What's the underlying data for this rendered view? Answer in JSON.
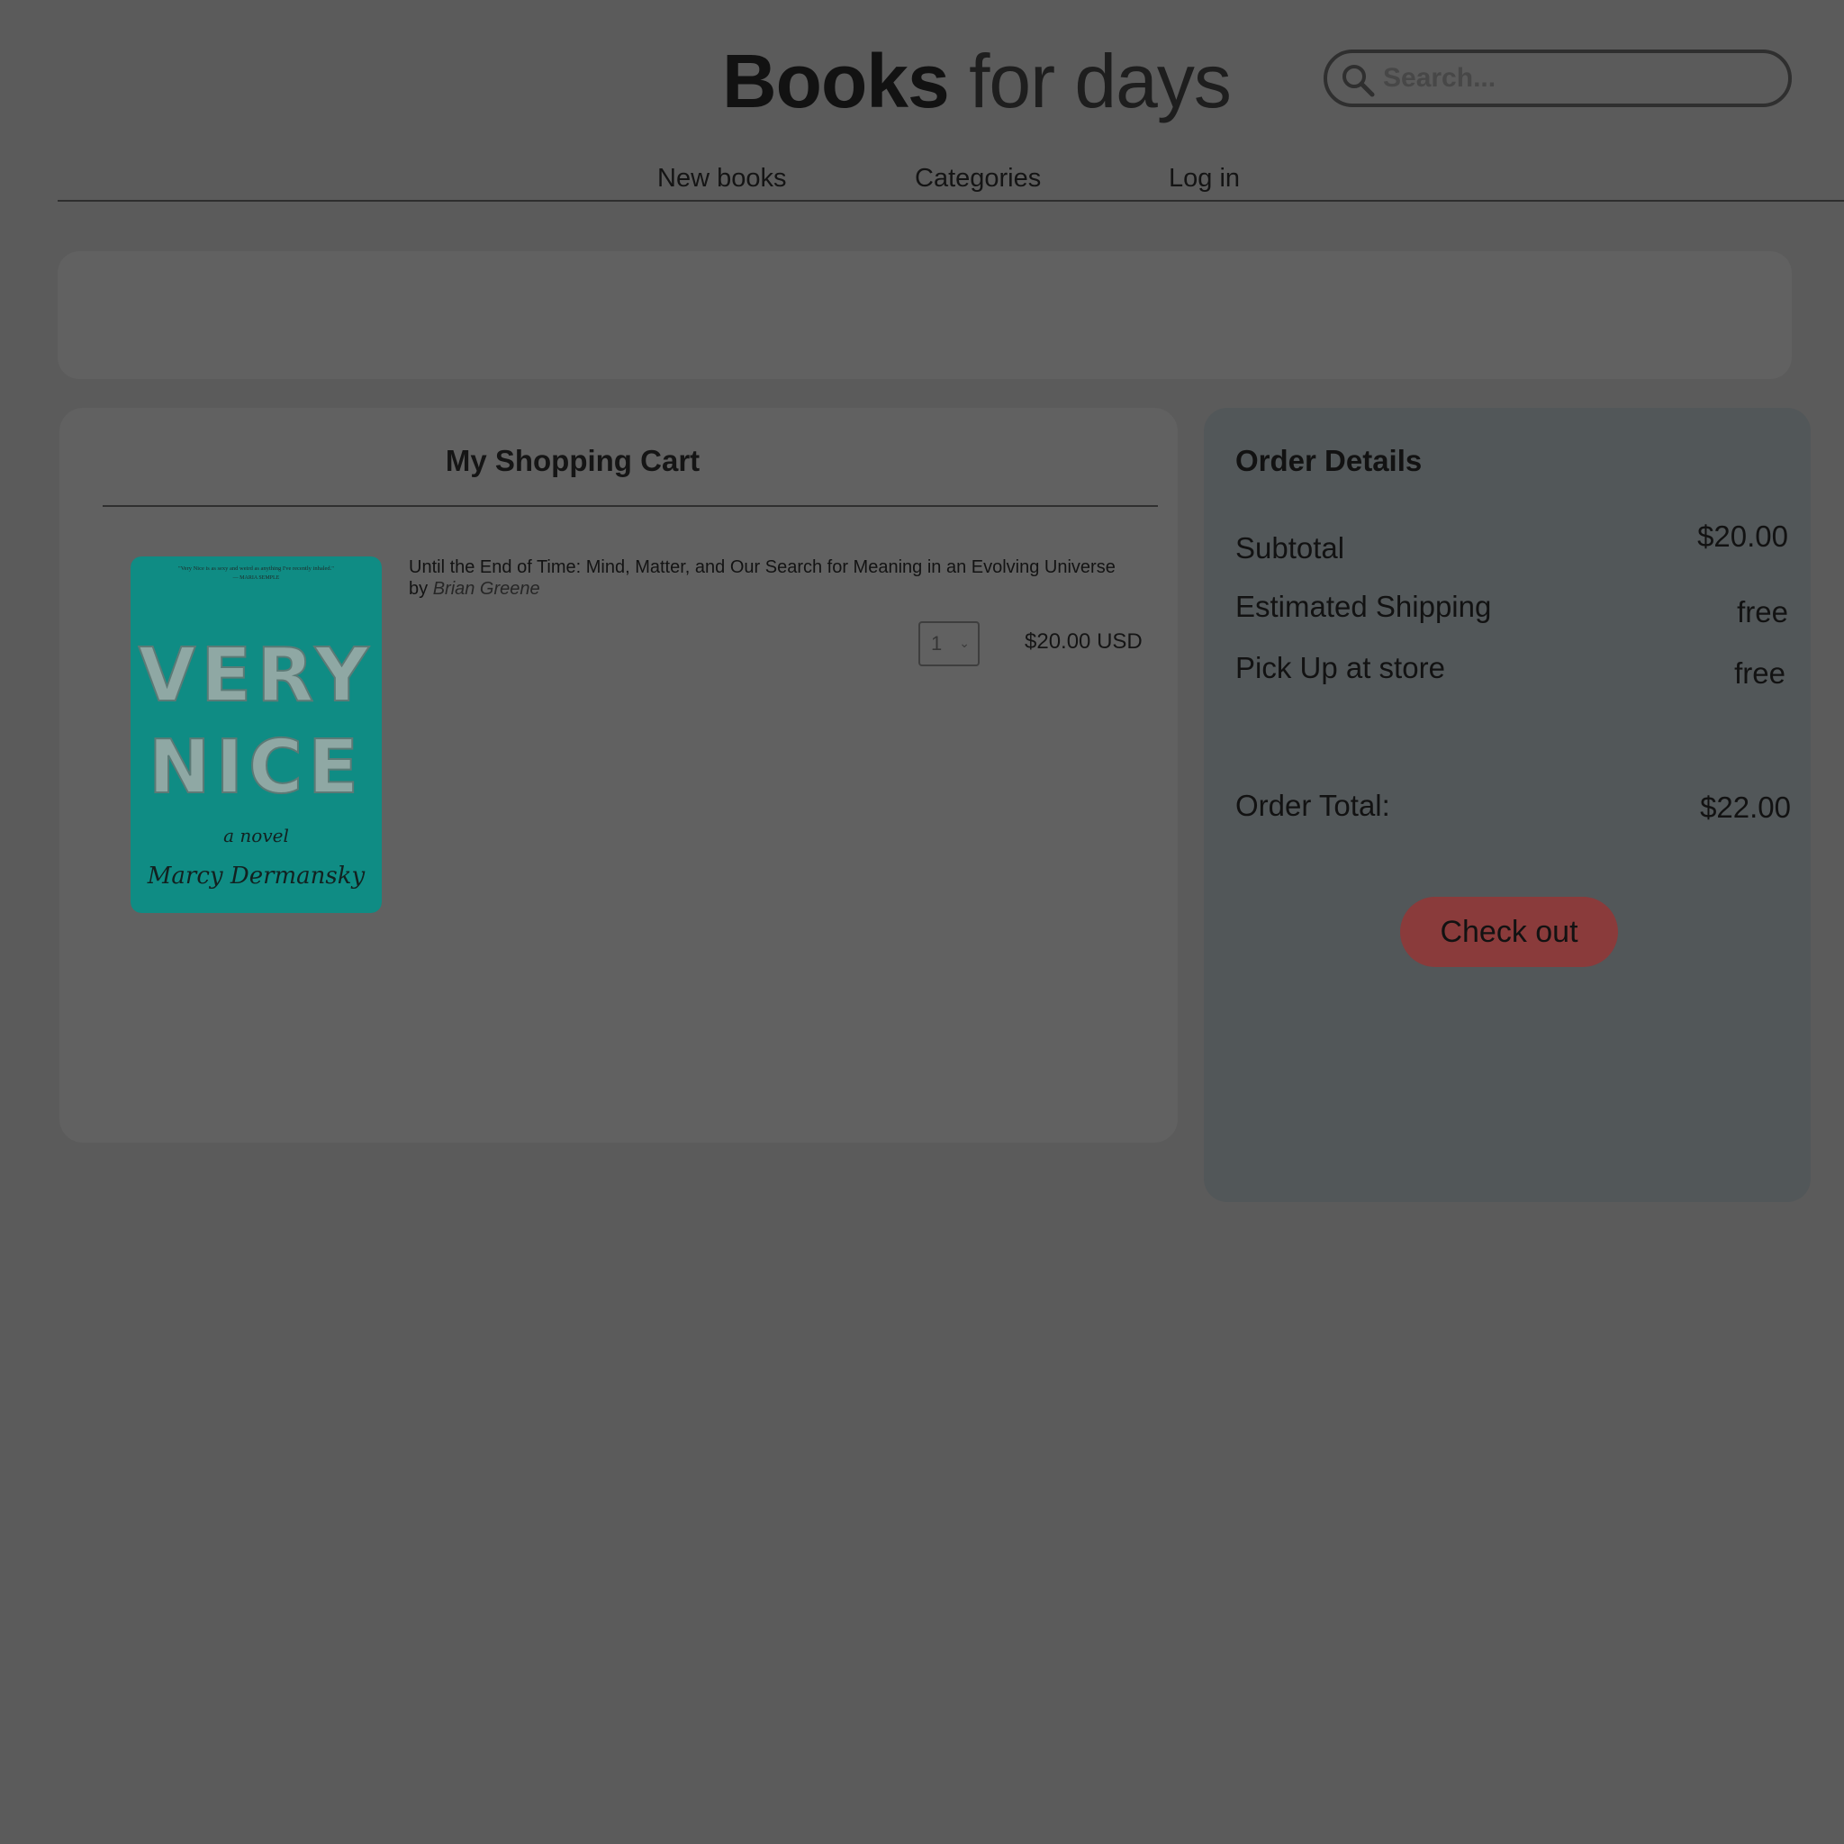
{
  "header": {
    "logo_bold": "Books",
    "logo_light": "for days",
    "search_placeholder": "Search..."
  },
  "nav": {
    "items": [
      {
        "label": "New books"
      },
      {
        "label": "Categories"
      },
      {
        "label": "Log in"
      }
    ]
  },
  "cart": {
    "title": "My Shopping Cart",
    "items": [
      {
        "title": "Until the End of Time: Mind, Matter, and Our Search for Meaning in an Evolving Universe",
        "by_label": "by",
        "author": "Brian Greene",
        "quantity": "1",
        "price": "$20.00 USD",
        "cover": {
          "blurb_line1": "\"Very Nice is as sexy and weird as anything I've recently inhaled.\"",
          "blurb_line2": "— MARIA SEMPLE",
          "title_line1": "VERY",
          "title_line2": "NICE",
          "subtitle": "a novel",
          "author": "Marcy Dermansky",
          "color": "#0f8c84"
        }
      }
    ]
  },
  "order": {
    "title": "Order Details",
    "subtotal_label": "Subtotal",
    "subtotal_value": "$20.00",
    "shipping_label": "Estimated Shipping",
    "shipping_value": "free",
    "pickup_label": "Pick Up at store",
    "pickup_value": "free",
    "total_label": "Order Total:",
    "total_value": "$22.00",
    "checkout_label": "Check out"
  },
  "colors": {
    "background": "#5b5b5b",
    "panel": "#616161",
    "order_panel": "#525759",
    "checkout_button": "#8a3b3b",
    "text": "#121212"
  }
}
